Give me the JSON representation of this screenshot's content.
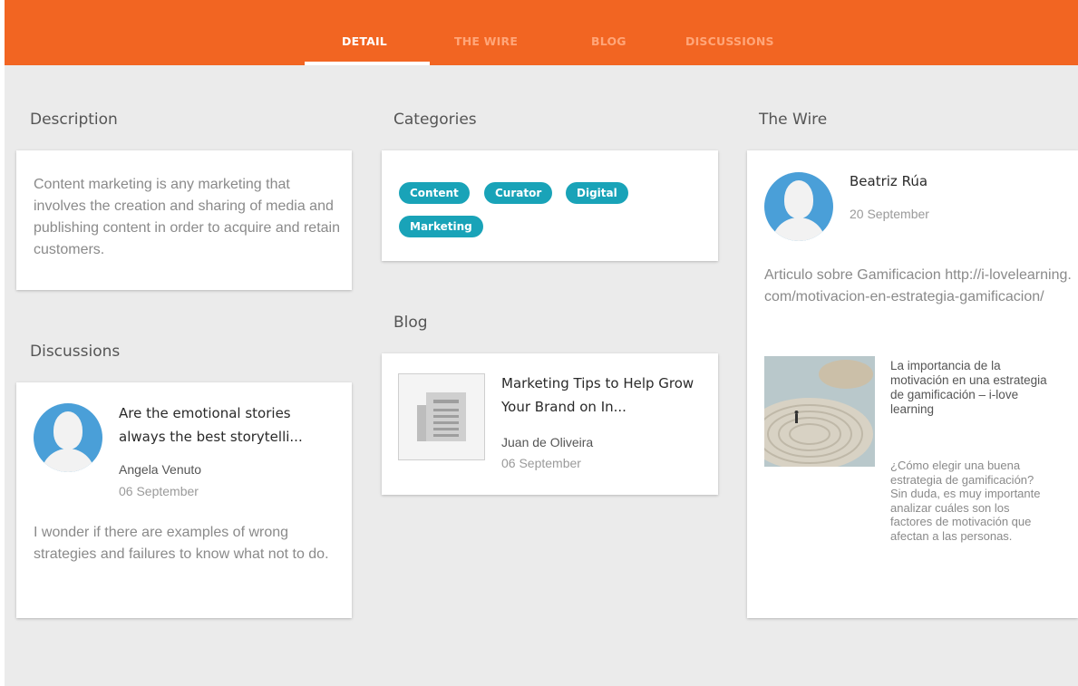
{
  "nav": {
    "tabs": [
      {
        "label": "DETAIL",
        "active": true
      },
      {
        "label": "THE WIRE",
        "active": false
      },
      {
        "label": "BLOG",
        "active": false
      },
      {
        "label": "DISCUSSIONS",
        "active": false
      }
    ]
  },
  "description": {
    "title": "Description",
    "text": "Content marketing is any marketing that involves the creation and sharing of media and publishing content in order to acquire and retain customers."
  },
  "categories": {
    "title": "Categories",
    "tags": [
      "Content",
      "Curator",
      "Digital",
      "Marketing"
    ]
  },
  "blog": {
    "title": "Blog",
    "post": {
      "title": "Marketing Tips to Help Grow Your Brand on In...",
      "author": "Juan de Oliveira",
      "date": "06 September"
    }
  },
  "discussions": {
    "title": "Discussions",
    "post": {
      "title": "Are the emotional stories always the best storytelli...",
      "author": "Angela Venuto",
      "date": "06 September",
      "text": "I wonder if there are examples of wrong strategies and failures to know what not to do."
    }
  },
  "wire": {
    "title": "The Wire",
    "post": {
      "author": "Beatriz Rúa",
      "date": "20 September",
      "text": "Articulo sobre Gamificacion http://i-lovelearning.com/motivacion-en-estrategia-gamificacion/",
      "link_title": "La importancia de la motivación en una estrategia de gamificación – i-love learning",
      "link_desc": "¿Cómo elegir una buena estrategia de gamificación? Sin duda, es muy importante analizar cuáles son los factores de motivación que afectan a las personas."
    }
  },
  "colors": {
    "topbar": "#f26522",
    "tag": "#19a3b8",
    "avatar": "#4a9fd8",
    "background": "#ebebeb"
  }
}
